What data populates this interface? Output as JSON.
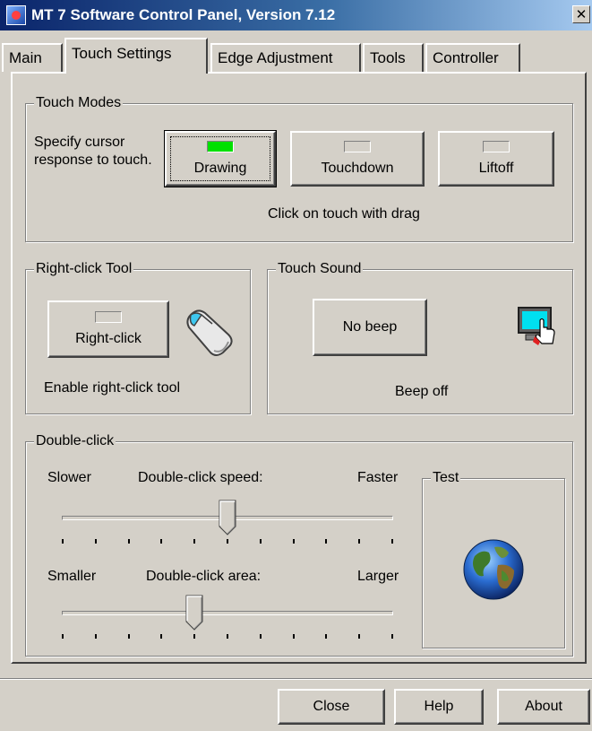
{
  "window": {
    "title": "MT 7 Software Control Panel, Version 7.12",
    "close_glyph": "✕"
  },
  "tabs": [
    {
      "label": "Main",
      "active": false
    },
    {
      "label": "Touch Settings",
      "active": true
    },
    {
      "label": "Edge Adjustment",
      "active": false
    },
    {
      "label": "Tools",
      "active": false
    },
    {
      "label": "Controller",
      "active": false
    }
  ],
  "touch_modes": {
    "legend": "Touch Modes",
    "description": "Specify cursor response to touch.",
    "buttons": [
      {
        "label": "Drawing",
        "indicator_on": true
      },
      {
        "label": "Touchdown",
        "indicator_on": false
      },
      {
        "label": "Liftoff",
        "indicator_on": false
      }
    ],
    "status": "Click on touch with drag"
  },
  "right_click_tool": {
    "legend": "Right-click Tool",
    "button_label": "Right-click",
    "indicator_on": false,
    "icon": "mouse-icon",
    "status": "Enable right-click tool"
  },
  "touch_sound": {
    "legend": "Touch Sound",
    "button_label": "No beep",
    "icon": "monitor-touch-icon",
    "status": "Beep off"
  },
  "double_click": {
    "legend": "Double-click",
    "speed": {
      "left_label": "Slower",
      "center_label": "Double-click speed:",
      "right_label": "Faster",
      "value": 0.5,
      "ticks": 11
    },
    "area": {
      "left_label": "Smaller",
      "center_label": "Double-click area:",
      "right_label": "Larger",
      "value": 0.4,
      "ticks": 11
    },
    "test": {
      "legend": "Test",
      "icon": "globe-icon"
    }
  },
  "footer": {
    "close_label": "Close",
    "help_label": "Help",
    "about_label": "About"
  },
  "colors": {
    "face": "#d4d0c8",
    "led_on": "#00e000",
    "title_start": "#0a246a",
    "title_end": "#a6caf0"
  }
}
